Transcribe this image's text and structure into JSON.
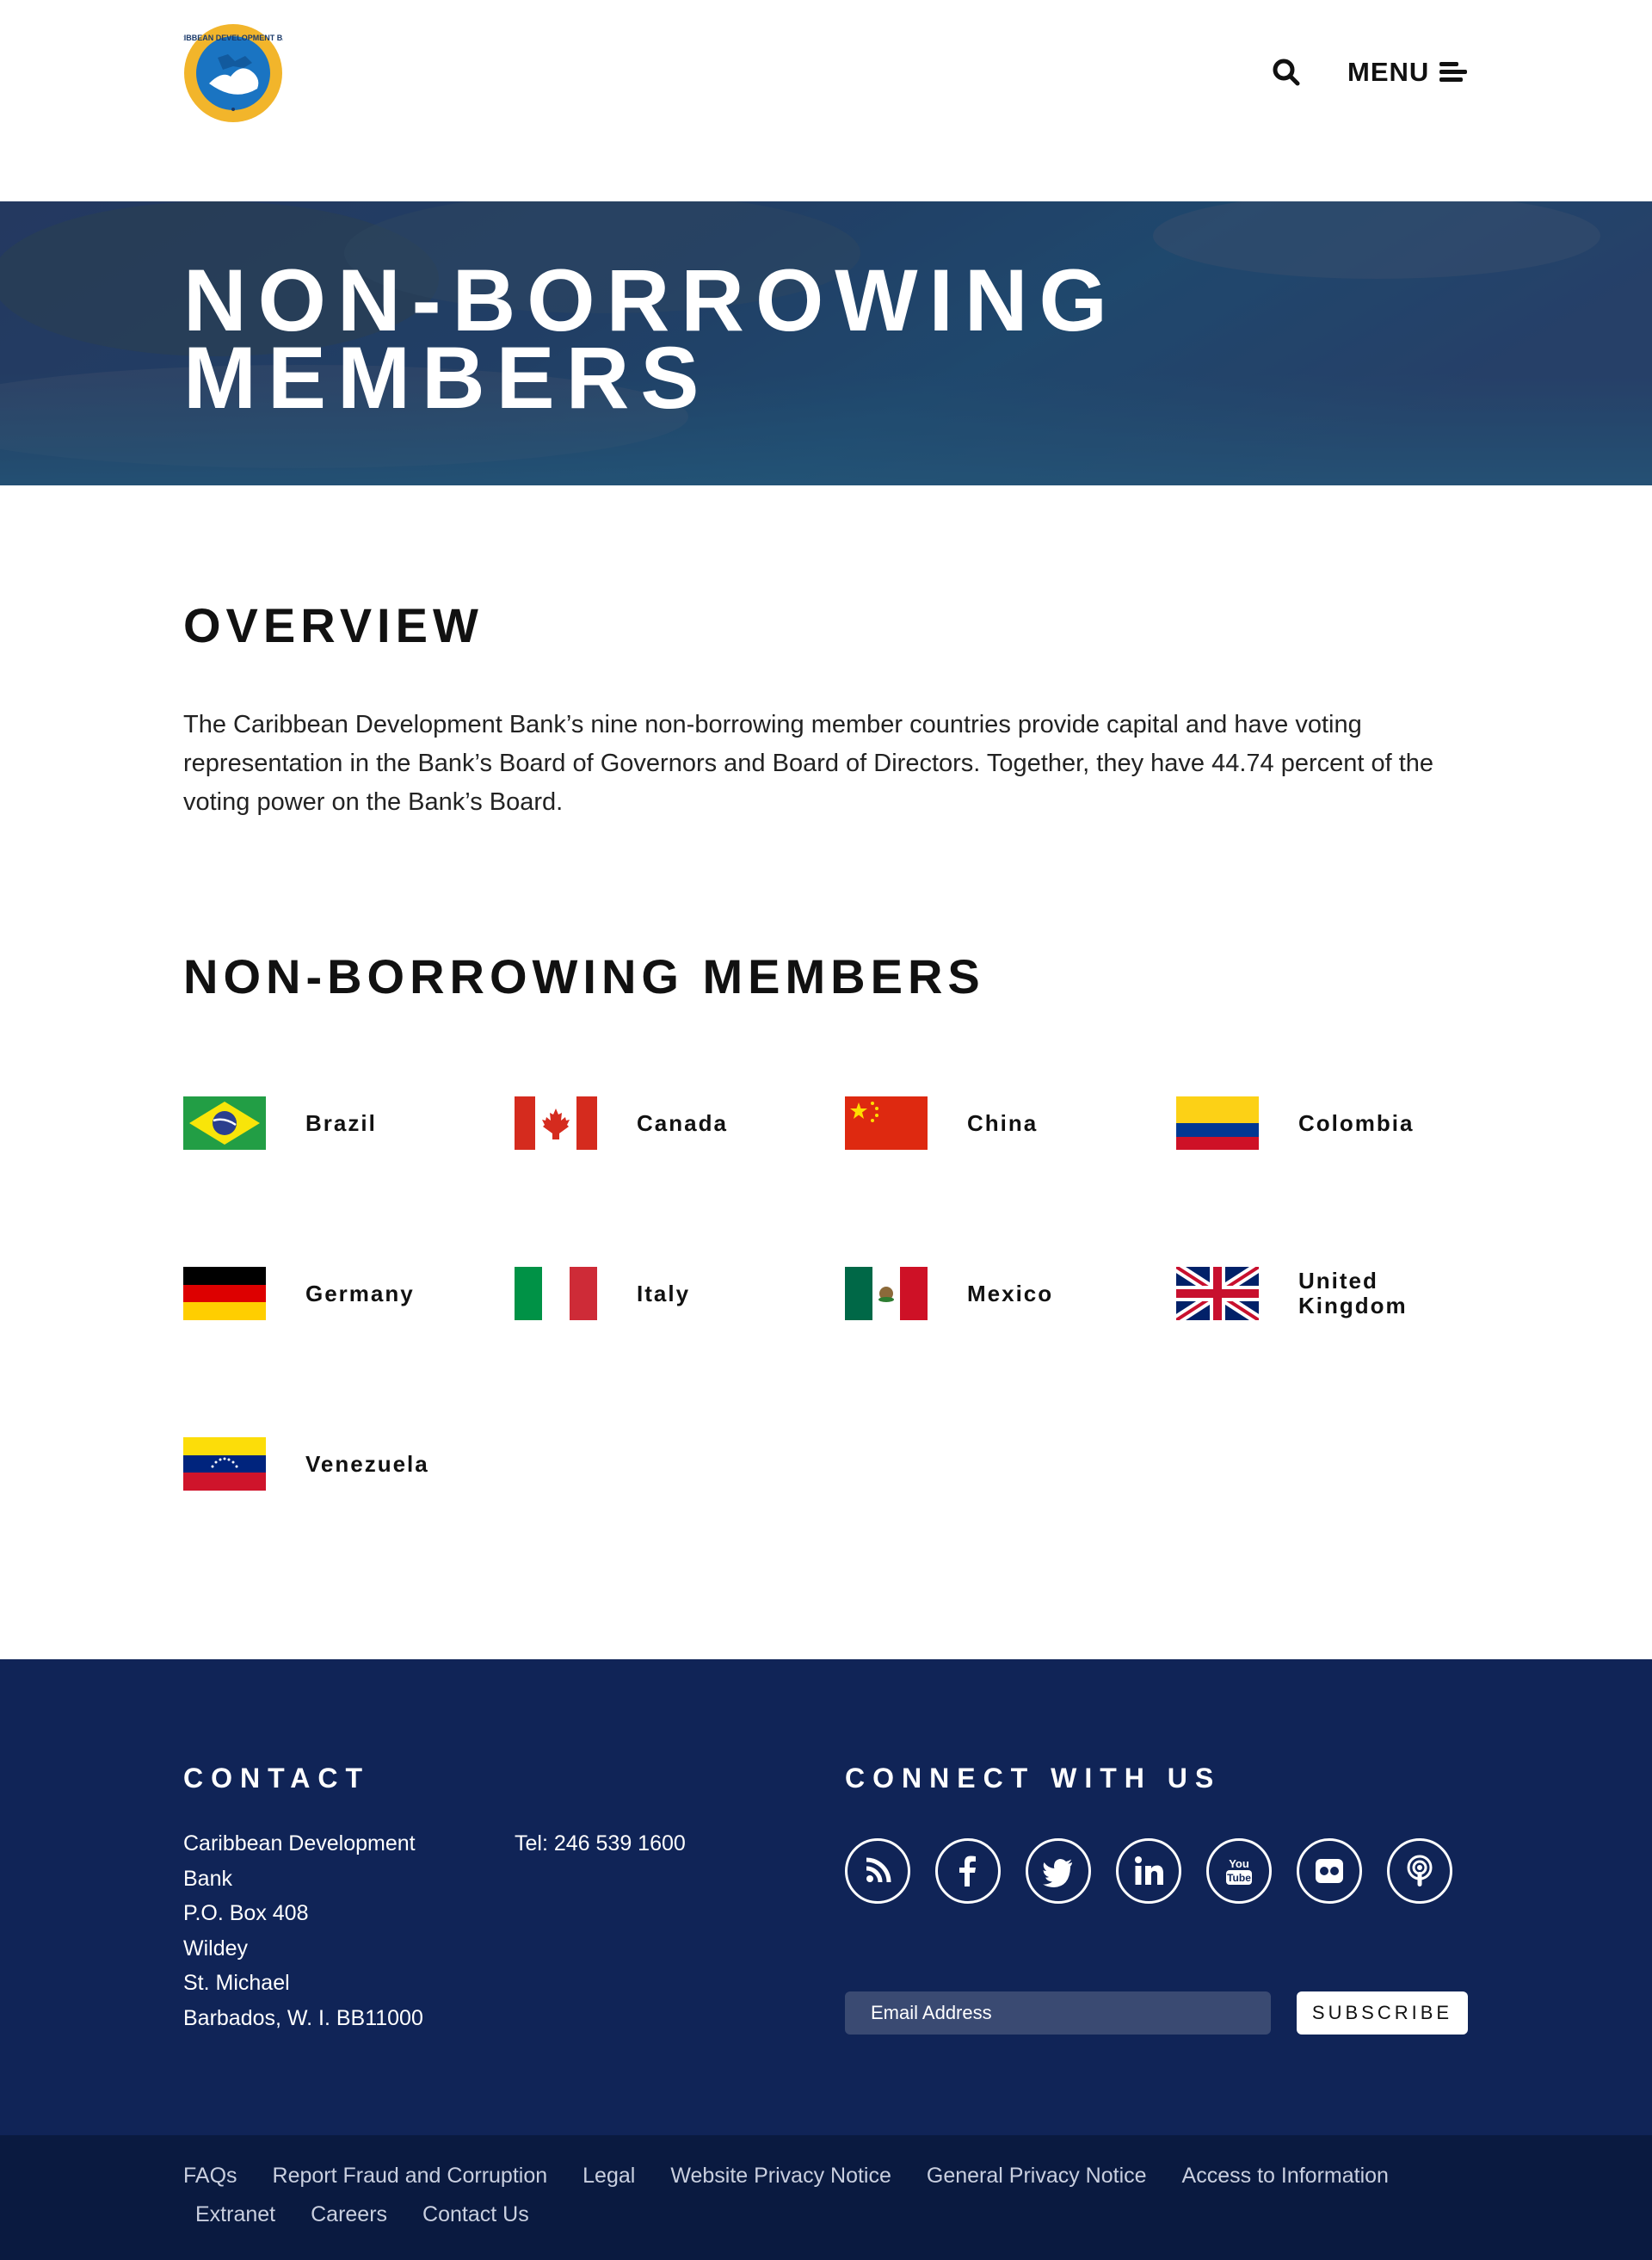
{
  "header": {
    "logo_text": "CARIBBEAN DEVELOPMENT BANK",
    "search_icon": "search-icon",
    "menu_label": "MENU",
    "menu_icon": "menu-icon"
  },
  "hero": {
    "title_line1": "NON-BORROWING",
    "title_line2": "MEMBERS"
  },
  "overview": {
    "heading": "OVERVIEW",
    "text": "The Caribbean Development Bank’s nine non-borrowing member countries provide capital and have voting representation in the Bank’s Board of Governors and Board of Directors. Together, they have 44.74 percent of the voting power on the Bank’s Board."
  },
  "members": {
    "heading": "NON-BORROWING MEMBERS",
    "items": [
      {
        "name": "Brazil",
        "flag": "brazil-flag"
      },
      {
        "name": "Canada",
        "flag": "canada-flag"
      },
      {
        "name": "China",
        "flag": "china-flag"
      },
      {
        "name": "Colombia",
        "flag": "colombia-flag"
      },
      {
        "name": "Germany",
        "flag": "germany-flag"
      },
      {
        "name": "Italy",
        "flag": "italy-flag"
      },
      {
        "name": "Mexico",
        "flag": "mexico-flag"
      },
      {
        "name": "United Kingdom",
        "flag": "united-kingdom-flag"
      },
      {
        "name": "Venezuela",
        "flag": "venezuela-flag"
      }
    ]
  },
  "footer": {
    "contact_heading": "CONTACT",
    "address_lines": [
      "Caribbean Development Bank",
      "P.O. Box 408",
      "Wildey",
      "St. Michael",
      "Barbados, W. I. BB11000"
    ],
    "tel": "Tel: 246 539 1600",
    "connect_heading": "CONNECT WITH US",
    "socials": [
      "rss-icon",
      "facebook-icon",
      "twitter-icon",
      "linkedin-icon",
      "youtube-icon",
      "flickr-icon",
      "podcast-icon"
    ],
    "email_placeholder": "Email Address",
    "subscribe_label": "SUBSCRIBE"
  },
  "bottom_links": [
    "FAQs",
    "Report Fraud and Corruption",
    "Legal",
    "Website Privacy Notice",
    "General Privacy Notice",
    "Access to Information",
    "Extranet",
    "Careers",
    "Contact Us"
  ],
  "colors": {
    "footer_bg": "#102457",
    "bottom_bar_bg": "#0a1a40",
    "logo_gold": "#f2b52b",
    "logo_blue": "#1a74c2"
  }
}
